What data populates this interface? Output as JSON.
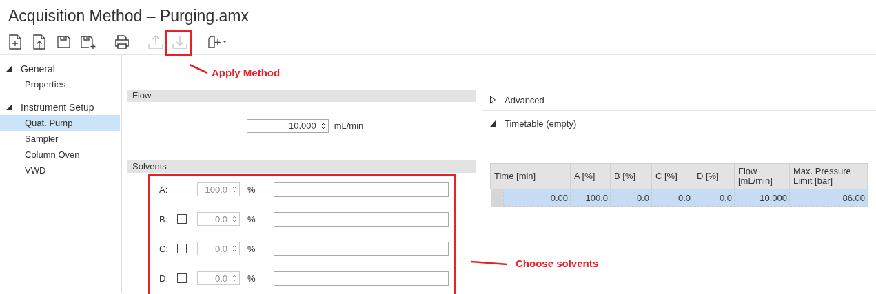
{
  "window": {
    "title": "Acquisition Method – Purging.amx"
  },
  "toolbar": [
    {
      "kind": "new",
      "disabled": false
    },
    {
      "kind": "open",
      "disabled": false
    },
    {
      "kind": "save",
      "disabled": false
    },
    {
      "kind": "save_as",
      "disabled": false
    },
    {
      "kind": "print",
      "disabled": false
    },
    {
      "kind": "upload",
      "disabled": true
    },
    {
      "kind": "download",
      "disabled": true
    },
    {
      "kind": "layout",
      "disabled": false
    }
  ],
  "sidebar": {
    "items": [
      {
        "label": "General",
        "expanded": true,
        "children": [
          {
            "label": "Properties",
            "selected": false
          }
        ]
      },
      {
        "label": "Instrument Setup",
        "expanded": true,
        "children": [
          {
            "label": "Quat. Pump",
            "selected": true
          },
          {
            "label": "Sampler",
            "selected": false
          },
          {
            "label": "Column Oven",
            "selected": false
          },
          {
            "label": "VWD",
            "selected": false
          }
        ]
      }
    ]
  },
  "flow": {
    "header": "Flow",
    "value": "10.000",
    "unit": "mL/min"
  },
  "solvents": {
    "header": "Solvents",
    "rows": [
      {
        "label": "A:",
        "kind": "fixed",
        "value": "100.0",
        "unit": "%",
        "disabled": true
      },
      {
        "label": "B:",
        "kind": "optional",
        "checked": false,
        "value": "0.0",
        "unit": "%",
        "disabled": true
      },
      {
        "label": "C:",
        "kind": "optional",
        "checked": false,
        "value": "0.0",
        "unit": "%",
        "disabled": true
      },
      {
        "label": "D:",
        "kind": "optional",
        "checked": false,
        "value": "0.0",
        "unit": "%",
        "disabled": true
      }
    ]
  },
  "sections": [
    {
      "label": "Advanced",
      "expanded": false
    },
    {
      "label": "Timetable (empty)",
      "expanded": true
    }
  ],
  "table": {
    "columns": [
      "Time [min]",
      "A [%]",
      "B [%]",
      "C [%]",
      "D [%]",
      "Flow [mL/min]",
      "Max. Pressure Limit [bar]"
    ],
    "rows": [
      {
        "selected": true,
        "cells": [
          "0.00",
          "100.0",
          "0.0",
          "0.0",
          "0.0",
          "10.000",
          "86.00"
        ]
      }
    ]
  },
  "annotations": [
    {
      "text": "Apply Method"
    },
    {
      "text": "Choose solvents"
    }
  ]
}
